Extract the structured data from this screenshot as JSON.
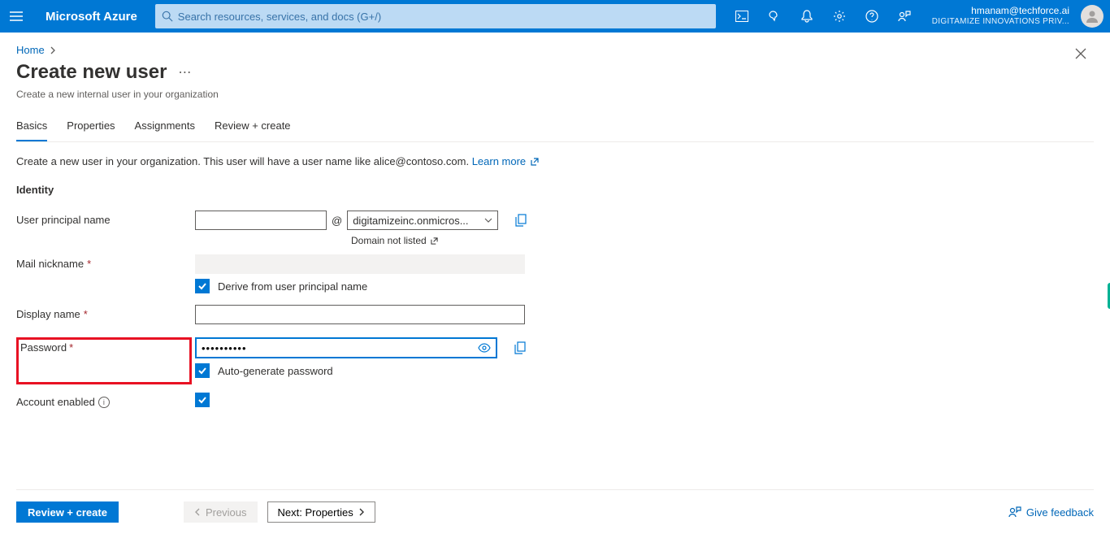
{
  "header": {
    "brand": "Microsoft Azure",
    "search_placeholder": "Search resources, services, and docs (G+/)",
    "account_email": "hmanam@techforce.ai",
    "account_tenant": "DIGITAMIZE INNOVATIONS PRIV..."
  },
  "breadcrumb": {
    "home": "Home"
  },
  "page": {
    "title": "Create new user",
    "subtitle": "Create a new internal user in your organization"
  },
  "tabs": {
    "basics": "Basics",
    "properties": "Properties",
    "assignments": "Assignments",
    "review": "Review + create"
  },
  "intro": {
    "text": "Create a new user in your organization. This user will have a user name like alice@contoso.com.",
    "learn_more": "Learn more"
  },
  "sections": {
    "identity": "Identity"
  },
  "labels": {
    "upn": "User principal name",
    "mail_nickname": "Mail nickname",
    "display_name": "Display name",
    "password": "Password",
    "account_enabled": "Account enabled"
  },
  "fields": {
    "upn_value": "",
    "at": "@",
    "domain_value": "digitamizeinc.onmicros...",
    "domain_hint": "Domain not listed",
    "mail_nickname_value": "",
    "derive_text": "Derive from user principal name",
    "derive_checked": true,
    "display_name_value": "",
    "password_value": "••••••••••",
    "autogen_text": "Auto-generate password",
    "autogen_checked": true,
    "account_enabled_checked": true
  },
  "footer": {
    "review": "Review + create",
    "previous": "Previous",
    "next": "Next: Properties",
    "feedback": "Give feedback"
  }
}
